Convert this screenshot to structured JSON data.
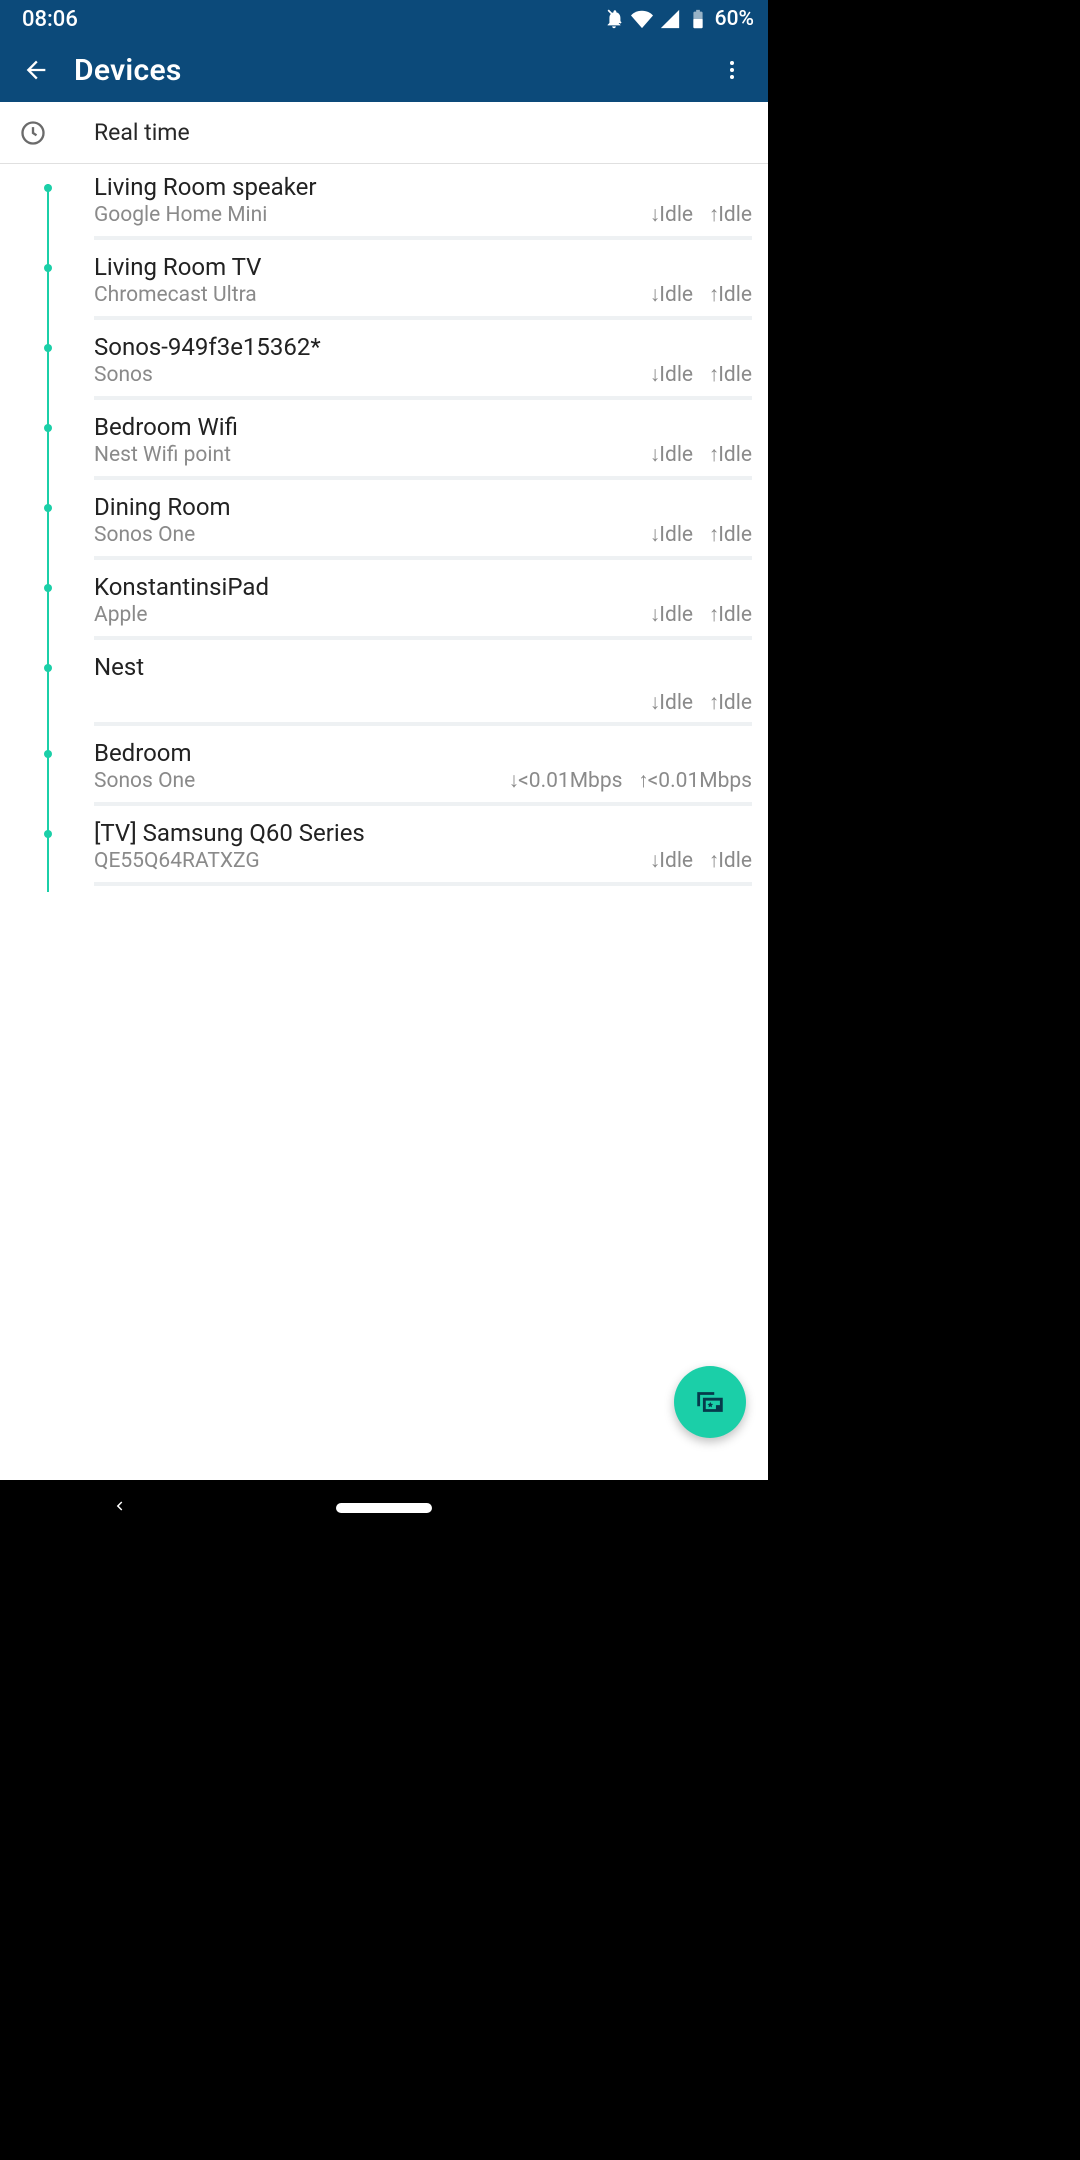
{
  "status": {
    "time": "08:06",
    "battery": "60%"
  },
  "appbar": {
    "title": "Devices"
  },
  "filter": {
    "label": "Real time"
  },
  "rates": {
    "down_arrow": "↓",
    "up_arrow": "↑"
  },
  "devices": [
    {
      "name": "Living Room speaker",
      "type": "Google Home Mini",
      "down": "Idle",
      "up": "Idle"
    },
    {
      "name": "Living Room TV",
      "type": "Chromecast Ultra",
      "down": "Idle",
      "up": "Idle"
    },
    {
      "name": "Sonos-949f3e15362*",
      "type": "Sonos",
      "down": "Idle",
      "up": "Idle"
    },
    {
      "name": "Bedroom Wifi",
      "type": "Nest Wifi point",
      "down": "Idle",
      "up": "Idle"
    },
    {
      "name": "Dining Room",
      "type": "Sonos One",
      "down": "Idle",
      "up": "Idle"
    },
    {
      "name": "KonstantinsiPad",
      "type": "Apple",
      "down": "Idle",
      "up": "Idle"
    },
    {
      "name": "Nest",
      "type": "",
      "down": "Idle",
      "up": "Idle"
    },
    {
      "name": "Bedroom",
      "type": "Sonos One",
      "down": "<0.01Mbps",
      "up": "<0.01Mbps"
    },
    {
      "name": "[TV] Samsung Q60 Series",
      "type": "QE55Q64RATXZG",
      "down": "Idle",
      "up": "Idle"
    }
  ]
}
